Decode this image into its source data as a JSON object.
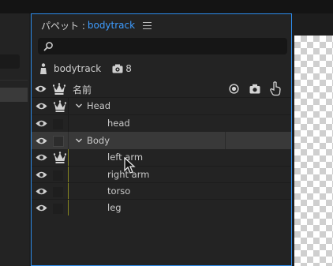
{
  "panel": {
    "title_prefix": "パペット :",
    "title_name": "bodytrack",
    "menu_icon": "hamburger-menu-icon",
    "accent_color": "#2d8ceb",
    "title_color": "#3d9cff"
  },
  "search": {
    "placeholder": "",
    "icon": "search-icon"
  },
  "puppet": {
    "name": "bodytrack",
    "handle_count": "8"
  },
  "columns": {
    "name_header": "名前"
  },
  "rows": [
    {
      "name": "Head",
      "type": "group",
      "expanded": true,
      "crown": true
    },
    {
      "name": "head",
      "type": "layer"
    },
    {
      "name": "Body",
      "type": "group",
      "expanded": true,
      "selected": true
    },
    {
      "name": "left arm",
      "type": "layer",
      "crown": true
    },
    {
      "name": "right arm",
      "type": "layer"
    },
    {
      "name": "torso",
      "type": "layer"
    },
    {
      "name": "leg",
      "type": "layer"
    }
  ]
}
